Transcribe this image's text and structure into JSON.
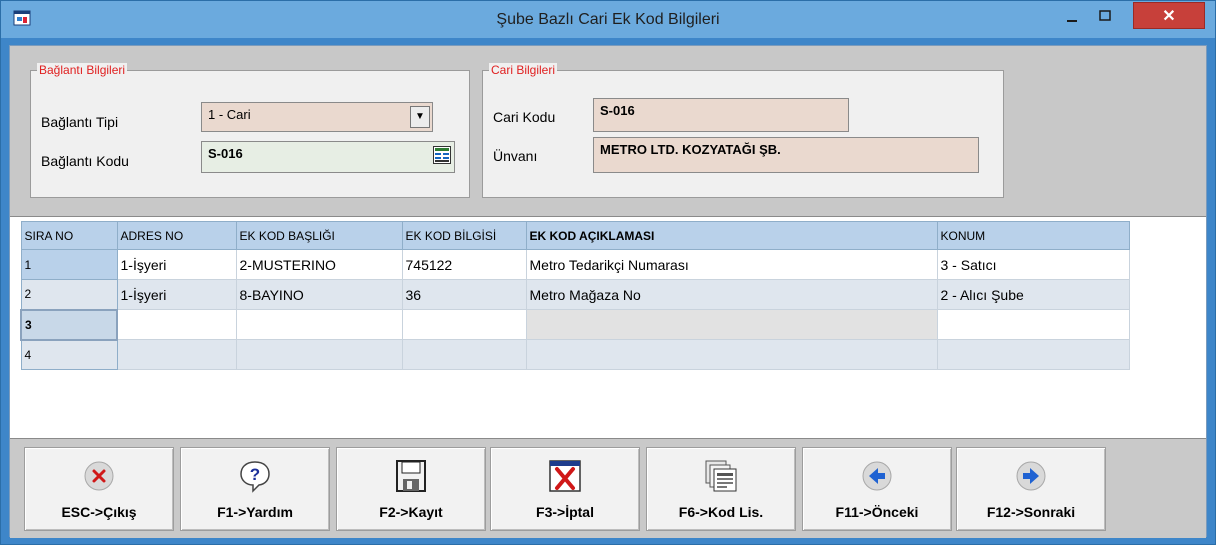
{
  "window": {
    "title": "Şube Bazlı Cari Ek Kod Bilgileri",
    "minimize_glyph": "–",
    "maximize_glyph": "□",
    "close_glyph": "✕",
    "app_icon": "app-window-icon"
  },
  "baglanti": {
    "group_title": "Bağlantı Bilgileri",
    "tip_label": "Bağlantı Tipi",
    "tip_value": "1 - Cari",
    "kod_label": "Bağlantı Kodu",
    "kod_value": "S-016"
  },
  "cari": {
    "group_title": "Cari Bilgileri",
    "kod_label": "Cari Kodu",
    "kod_value": "S-016",
    "unvan_label": "Ünvanı",
    "unvan_value": "METRO LTD. KOZYATAĞI ŞB."
  },
  "grid": {
    "columns": [
      "SIRA NO",
      "ADRES NO",
      "EK KOD BAŞLIĞI",
      "EK KOD BİLGİSİ",
      "EK KOD AÇIKLAMASI",
      "KONUM"
    ],
    "rows": [
      {
        "no": "1",
        "adres": "1-İşyeri",
        "baslik": "2-MUSTERINO",
        "bilgi": "745122",
        "aciklama": "Metro Tedarikçi Numarası",
        "konum": "3 - Satıcı"
      },
      {
        "no": "2",
        "adres": "1-İşyeri",
        "baslik": "8-BAYINO",
        "bilgi": "36",
        "aciklama": "Metro Mağaza No",
        "konum": "2 - Alıcı Şube"
      },
      {
        "no": "3",
        "adres": "",
        "baslik": "",
        "bilgi": "",
        "aciklama": "",
        "konum": ""
      },
      {
        "no": "4",
        "adres": "",
        "baslik": "",
        "bilgi": "",
        "aciklama": "",
        "konum": ""
      }
    ]
  },
  "toolbar": {
    "buttons": [
      {
        "label": "ESC->Çıkış",
        "icon": "exit-icon"
      },
      {
        "label": "F1->Yardım",
        "icon": "help-icon"
      },
      {
        "label": "F2->Kayıt",
        "icon": "save-icon"
      },
      {
        "label": "F3->İptal",
        "icon": "cancel-icon"
      },
      {
        "label": "F6->Kod Lis.",
        "icon": "code-list-icon"
      },
      {
        "label": "F11->Önceki",
        "icon": "previous-icon"
      },
      {
        "label": "F12->Sonraki",
        "icon": "next-icon"
      }
    ]
  },
  "colors": {
    "titlebar": "#6baade",
    "group_title": "#e02020",
    "field_bg": "#ead9cf",
    "grid_header": "#b9d1ea",
    "close_button": "#c7403a"
  }
}
